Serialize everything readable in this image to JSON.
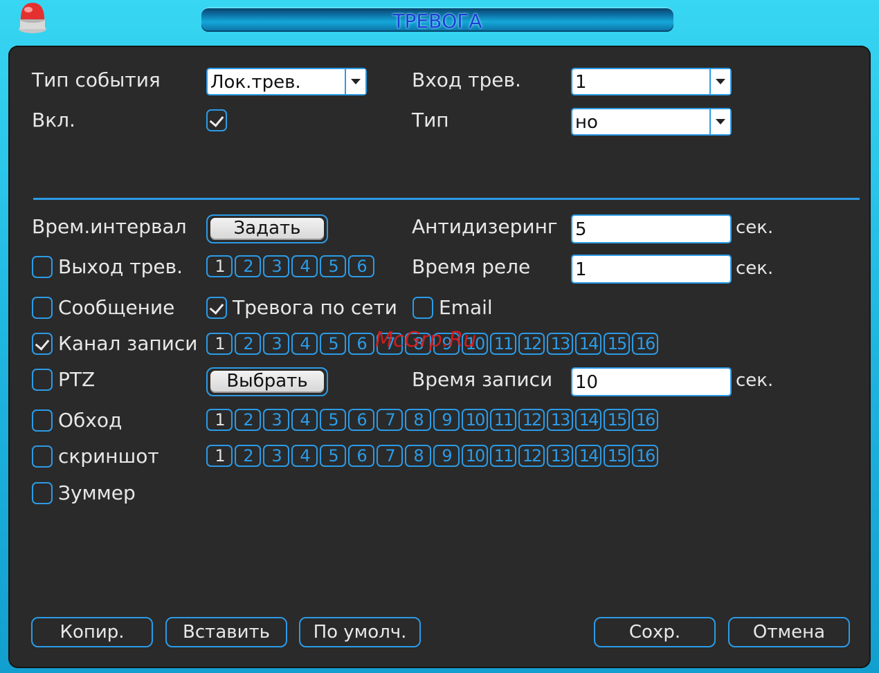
{
  "window": {
    "title": "ТРЕВОГА"
  },
  "event": {
    "type_label": "Тип события",
    "type_value": "Лок.трев.",
    "input_label": "Вход трев.",
    "input_value": "1",
    "enable_label": "Вкл.",
    "enable_checked": true,
    "kind_label": "Тип",
    "kind_value": "но"
  },
  "settings": {
    "period_label": "Врем.интервал",
    "period_button": "Задать",
    "debounce_label": "Антидизеринг",
    "debounce_value": "5",
    "debounce_unit": "сек.",
    "alarm_out_label": "Выход трев.",
    "relay_time_label": "Время реле",
    "relay_time_value": "1",
    "relay_time_unit": "сек.",
    "message_label": "Сообщение",
    "net_alarm_label": "Тревога по сети",
    "email_label": "Email",
    "record_channel_label": "Канал записи",
    "ptz_label": "PTZ",
    "ptz_button": "Выбрать",
    "record_time_label": "Время записи",
    "record_time_value": "10",
    "record_time_unit": "сек.",
    "tour_label": "Обход",
    "snapshot_label": "скриншот",
    "buzzer_label": "Зуммер"
  },
  "channels": {
    "alarm_out": [
      "1",
      "2",
      "3",
      "4",
      "5",
      "6"
    ],
    "record": [
      "1",
      "2",
      "3",
      "4",
      "5",
      "6",
      "7",
      "8",
      "9",
      "10",
      "11",
      "12",
      "13",
      "14",
      "15",
      "16"
    ],
    "tour": [
      "1",
      "2",
      "3",
      "4",
      "5",
      "6",
      "7",
      "8",
      "9",
      "10",
      "11",
      "12",
      "13",
      "14",
      "15",
      "16"
    ],
    "snapshot": [
      "1",
      "2",
      "3",
      "4",
      "5",
      "6",
      "7",
      "8",
      "9",
      "10",
      "11",
      "12",
      "13",
      "14",
      "15",
      "16"
    ]
  },
  "footer": {
    "copy": "Копир.",
    "paste": "Вставить",
    "default": "По умолч.",
    "save": "Сохр.",
    "cancel": "Отмена"
  },
  "watermark": "McGrp.Ru",
  "colors": {
    "accent": "#2c9be6",
    "frame": "#1fb6e0",
    "panel": "#2a2a2a",
    "title_text": "#1b3fd6",
    "watermark": "#e01b1b"
  }
}
